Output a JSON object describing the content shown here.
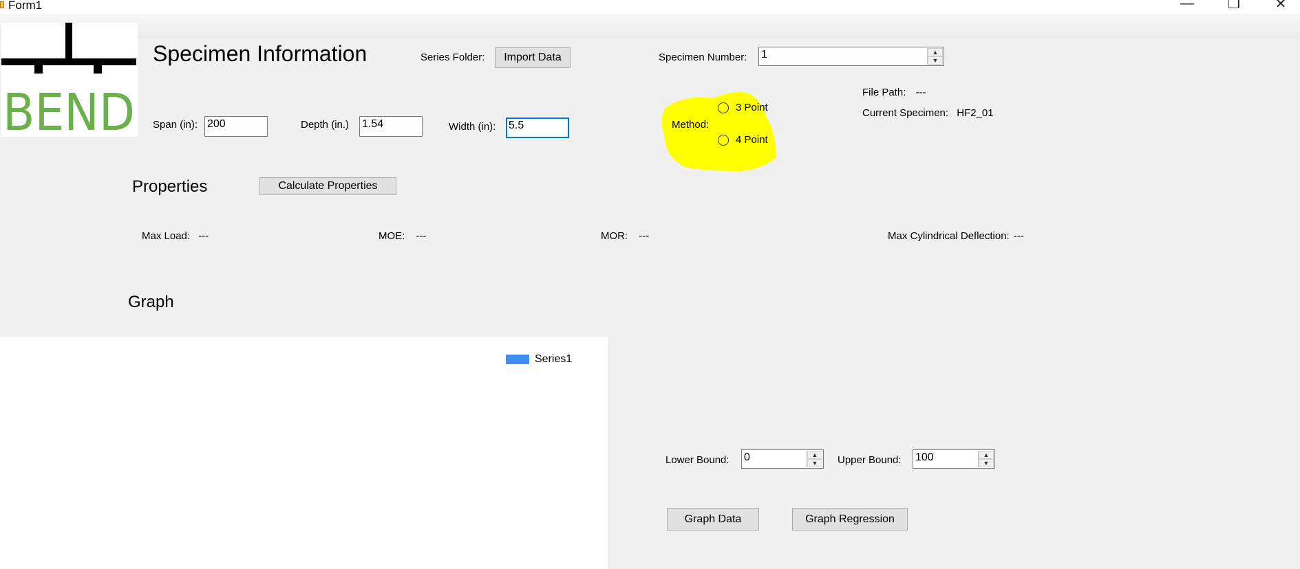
{
  "window": {
    "title": "Form1",
    "controls": {
      "minimize": "—",
      "maximize": "❐",
      "close": "✕"
    }
  },
  "logo": {
    "text": "BEND",
    "colors": {
      "bar": "#000000",
      "text": "#6ab04c"
    }
  },
  "specimen": {
    "heading": "Specimen Information",
    "series_folder_label": "Series Folder:",
    "import_button": "Import Data",
    "specimen_number_label": "Specimen Number:",
    "specimen_number_value": "1",
    "span_label": "Span (in):",
    "span_value": "200",
    "depth_label": "Depth (in.)",
    "depth_value": "1.54",
    "width_label": "Width (in):",
    "width_value": "5.5",
    "method_label": "Method:",
    "method_options": [
      "3 Point",
      "4 Point"
    ],
    "highlight_color": "#ffff00",
    "file_path_label": "File Path:",
    "file_path_value": "---",
    "current_specimen_label": "Current Specimen:",
    "current_specimen_value": "HF2_01"
  },
  "properties": {
    "heading": "Properties",
    "calculate_button": "Calculate Properties",
    "max_load_label": "Max Load:",
    "max_load_value": "---",
    "moe_label": "MOE:",
    "moe_value": "---",
    "mor_label": "MOR:",
    "mor_value": "---",
    "max_deflection_label": "Max Cylindrical Deflection:",
    "max_deflection_value": "---"
  },
  "graph": {
    "heading": "Graph",
    "legend": {
      "series_name": "Series1",
      "color": "#418cf0"
    },
    "lower_bound_label": "Lower Bound:",
    "lower_bound_value": "0",
    "upper_bound_label": "Upper Bound:",
    "upper_bound_value": "100",
    "graph_data_button": "Graph Data",
    "graph_regression_button": "Graph Regression"
  }
}
